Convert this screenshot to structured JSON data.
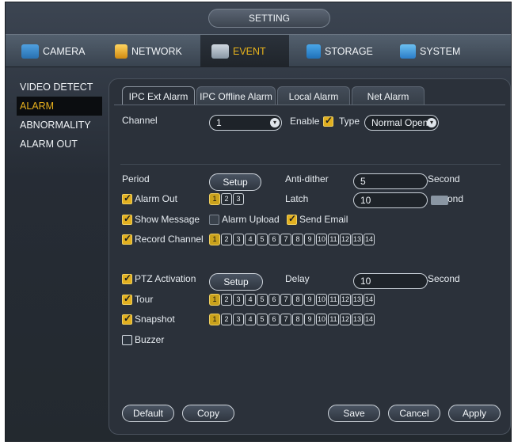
{
  "window": {
    "title": "SETTING"
  },
  "topnav": {
    "tabs": [
      {
        "label": "CAMERA",
        "icon": "camera-icon"
      },
      {
        "label": "NETWORK",
        "icon": "network-icon"
      },
      {
        "label": "EVENT",
        "icon": "event-icon",
        "active": true
      },
      {
        "label": "STORAGE",
        "icon": "storage-icon"
      },
      {
        "label": "SYSTEM",
        "icon": "system-icon"
      }
    ]
  },
  "sidebar": {
    "items": [
      {
        "label": "VIDEO DETECT"
      },
      {
        "label": "ALARM",
        "active": true
      },
      {
        "label": "ABNORMALITY"
      },
      {
        "label": "ALARM OUT"
      }
    ]
  },
  "subtabs": [
    {
      "label": "IPC Ext Alarm",
      "active": true
    },
    {
      "label": "IPC Offline Alarm"
    },
    {
      "label": "Local Alarm"
    },
    {
      "label": "Net Alarm"
    }
  ],
  "form": {
    "channel_label": "Channel",
    "channel_value": "1",
    "enable_label": "Enable",
    "type_label": "Type",
    "type_value": "Normal Open",
    "period_label": "Period",
    "setup_label": "Setup",
    "anti_dither_label": "Anti-dither",
    "anti_dither_value": "5",
    "second_label": "Second",
    "alarm_out_label": "Alarm Out",
    "alarm_out_channels": [
      "1",
      "2",
      "3"
    ],
    "latch_label": "Latch",
    "latch_value": "10",
    "latch_unit": "ond",
    "show_message_label": "Show Message",
    "alarm_upload_label": "Alarm Upload",
    "send_email_label": "Send Email",
    "record_channel_label": "Record Channel",
    "channels": [
      "1",
      "2",
      "3",
      "4",
      "5",
      "6",
      "7",
      "8",
      "9",
      "10",
      "11",
      "12",
      "13",
      "14"
    ],
    "ptz_label": "PTZ Activation",
    "ptz_setup_label": "Setup",
    "delay_label": "Delay",
    "delay_value": "10",
    "delay_unit": "Second",
    "tour_label": "Tour",
    "snapshot_label": "Snapshot",
    "buzzer_label": "Buzzer"
  },
  "buttons": {
    "default": "Default",
    "copy": "Copy",
    "save": "Save",
    "cancel": "Cancel",
    "apply": "Apply"
  },
  "colors": {
    "accent": "#e7b01d",
    "background": "#2b313a"
  }
}
